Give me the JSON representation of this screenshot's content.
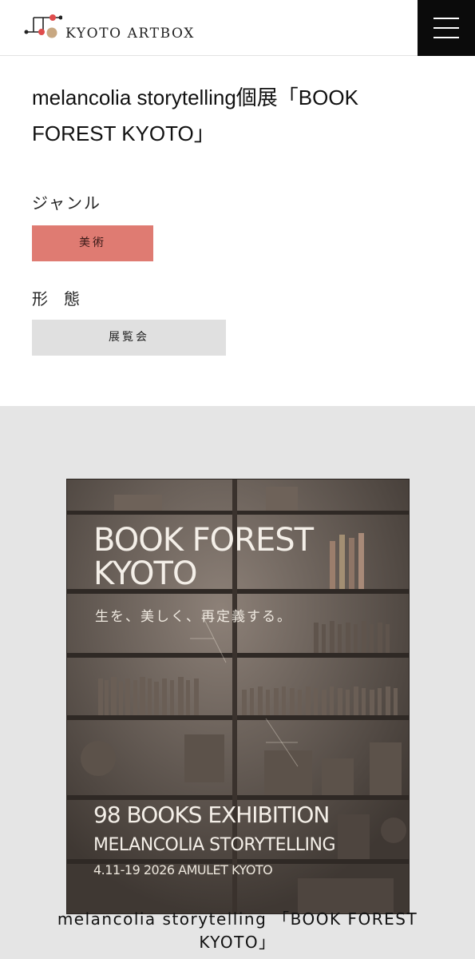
{
  "header": {
    "logo_text": "KYOTO ARTBOX",
    "menu_icon": "hamburger-menu-icon"
  },
  "event": {
    "title": "melancolia storytelling個展「BOOK FOREST KYOTO」"
  },
  "genre": {
    "label": "ジャンル",
    "value": "美術",
    "color": "#df7b72"
  },
  "form": {
    "label": "形態",
    "value": "展覧会"
  },
  "poster": {
    "title_line1": "BOOK FOREST",
    "title_line2": "KYOTO",
    "tagline": "生を、美しく、再定義する。",
    "exhibition": "98 BOOKS EXHIBITION",
    "artist": "MELANCOLIA STORYTELLING",
    "dates": "4.11-19 2026 AMULET KYOTO"
  },
  "caption": "melancolia storytelling 「BOOK FOREST KYOTO」"
}
